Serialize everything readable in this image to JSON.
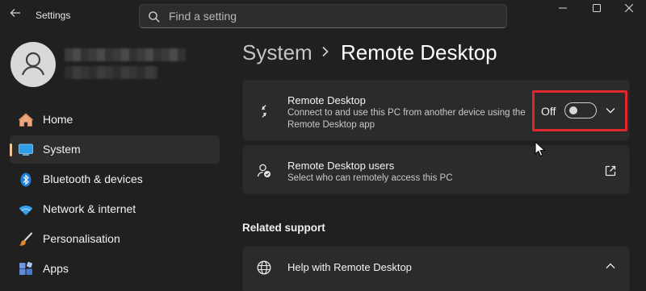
{
  "app": {
    "title": "Settings"
  },
  "search": {
    "placeholder": "Find a setting"
  },
  "sidebar": {
    "items": [
      {
        "label": "Home",
        "icon": "home-icon"
      },
      {
        "label": "System",
        "icon": "system-monitor-icon",
        "active": true
      },
      {
        "label": "Bluetooth & devices",
        "icon": "bluetooth-icon"
      },
      {
        "label": "Network & internet",
        "icon": "wifi-icon"
      },
      {
        "label": "Personalisation",
        "icon": "paintbrush-icon"
      },
      {
        "label": "Apps",
        "icon": "apps-icon"
      }
    ]
  },
  "breadcrumb": {
    "parent": "System",
    "current": "Remote Desktop"
  },
  "remote_desktop": {
    "title": "Remote Desktop",
    "description": "Connect to and use this PC from another device using the Remote Desktop app",
    "toggle_label": "Off",
    "toggle_on": false
  },
  "remote_users": {
    "title": "Remote Desktop users",
    "description": "Select who can remotely access this PC"
  },
  "related": {
    "heading": "Related support",
    "help_title": "Help with Remote Desktop"
  },
  "colors": {
    "accent": "#f0c89a",
    "highlight": "#e0262e",
    "background": "#202020",
    "card": "#2b2b2b"
  }
}
